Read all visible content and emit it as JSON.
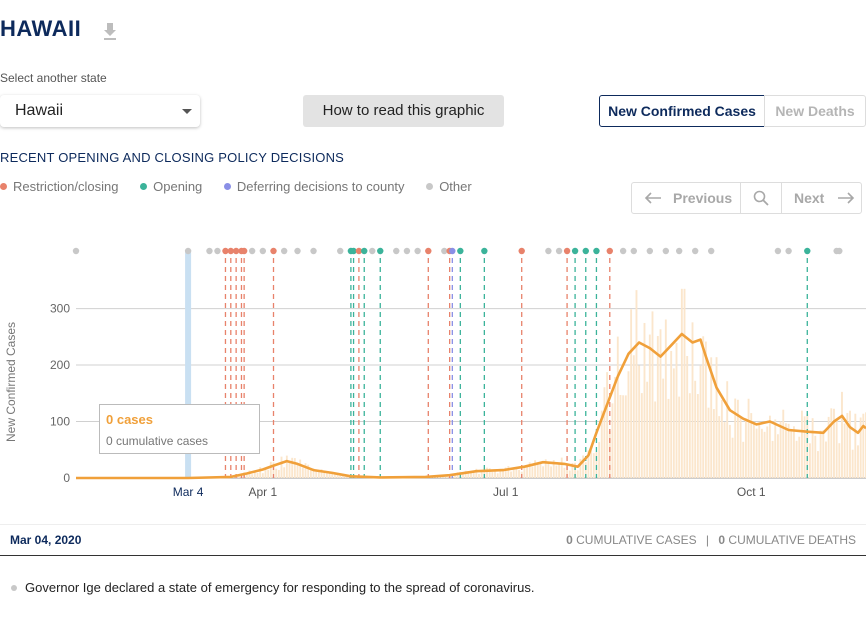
{
  "header": {
    "title": "HAWAII"
  },
  "state_selector": {
    "label": "Select another state",
    "value": "Hawaii"
  },
  "how_to_button": "How to read this graphic",
  "toggle": {
    "cases_label": "New Confirmed Cases",
    "deaths_label": "New Deaths"
  },
  "policy": {
    "heading": "RECENT OPENING AND CLOSING POLICY DECISIONS",
    "legend": [
      {
        "label": "Restriction/closing",
        "color": "#e8826b"
      },
      {
        "label": "Opening",
        "color": "#3bb39a"
      },
      {
        "label": "Deferring decisions to county",
        "color": "#8a8fe6"
      },
      {
        "label": "Other",
        "color": "#c8c8c8"
      }
    ]
  },
  "pager": {
    "prev_label": "Previous",
    "next_label": "Next"
  },
  "colors": {
    "line": "#f0a03a",
    "bars": "#fbe6cc",
    "selected_day": "#c9e0f2",
    "restriction": "#e8826b",
    "opening": "#3bb39a",
    "deferring": "#8a8fe6",
    "other": "#c8c8c8"
  },
  "chart_data": {
    "type": "line",
    "ylabel": "New Confirmed Cases",
    "yticks": [
      0,
      100,
      200,
      300
    ],
    "ylim": [
      0,
      340
    ],
    "x_domain": [
      "2020-01-22",
      "2020-11-13"
    ],
    "x_ticks": [
      {
        "date": "2020-03-04",
        "label": "Mar 4",
        "selected": true
      },
      {
        "date": "2020-04-01",
        "label": "Apr 1",
        "selected": false
      },
      {
        "date": "2020-07-01",
        "label": "Jul 1",
        "selected": false
      },
      {
        "date": "2020-10-01",
        "label": "Oct 1",
        "selected": false
      }
    ],
    "selected_date": "2020-03-04",
    "series": [
      {
        "kind": "moving-average line",
        "points": [
          [
            "2020-01-22",
            0
          ],
          [
            "2020-03-04",
            0
          ],
          [
            "2020-03-20",
            2
          ],
          [
            "2020-03-26",
            8
          ],
          [
            "2020-04-01",
            15
          ],
          [
            "2020-04-05",
            22
          ],
          [
            "2020-04-10",
            30
          ],
          [
            "2020-04-14",
            25
          ],
          [
            "2020-04-20",
            14
          ],
          [
            "2020-04-27",
            9
          ],
          [
            "2020-05-04",
            3
          ],
          [
            "2020-05-15",
            1
          ],
          [
            "2020-06-01",
            2
          ],
          [
            "2020-06-10",
            5
          ],
          [
            "2020-06-20",
            12
          ],
          [
            "2020-06-30",
            14
          ],
          [
            "2020-07-08",
            20
          ],
          [
            "2020-07-15",
            28
          ],
          [
            "2020-07-23",
            25
          ],
          [
            "2020-07-28",
            20
          ],
          [
            "2020-08-01",
            40
          ],
          [
            "2020-08-04",
            80
          ],
          [
            "2020-08-08",
            130
          ],
          [
            "2020-08-12",
            180
          ],
          [
            "2020-08-16",
            220
          ],
          [
            "2020-08-20",
            240
          ],
          [
            "2020-08-24",
            230
          ],
          [
            "2020-08-28",
            215
          ],
          [
            "2020-09-01",
            235
          ],
          [
            "2020-09-05",
            255
          ],
          [
            "2020-09-09",
            240
          ],
          [
            "2020-09-12",
            245
          ],
          [
            "2020-09-14",
            215
          ],
          [
            "2020-09-18",
            160
          ],
          [
            "2020-09-23",
            120
          ],
          [
            "2020-09-28",
            105
          ],
          [
            "2020-10-03",
            95
          ],
          [
            "2020-10-08",
            100
          ],
          [
            "2020-10-15",
            85
          ],
          [
            "2020-10-22",
            82
          ],
          [
            "2020-10-28",
            80
          ],
          [
            "2020-11-01",
            100
          ],
          [
            "2020-11-04",
            110
          ],
          [
            "2020-11-07",
            90
          ],
          [
            "2020-11-10",
            80
          ],
          [
            "2020-11-12",
            92
          ],
          [
            "2020-11-13",
            88
          ]
        ]
      }
    ],
    "policy_events": [
      {
        "date": "2020-01-22",
        "type": "other"
      },
      {
        "date": "2020-03-04",
        "type": "other"
      },
      {
        "date": "2020-03-12",
        "type": "other"
      },
      {
        "date": "2020-03-15",
        "type": "other"
      },
      {
        "date": "2020-03-18",
        "type": "restriction"
      },
      {
        "date": "2020-03-20",
        "type": "restriction"
      },
      {
        "date": "2020-03-22",
        "type": "restriction"
      },
      {
        "date": "2020-03-24",
        "type": "restriction"
      },
      {
        "date": "2020-03-25",
        "type": "restriction"
      },
      {
        "date": "2020-03-28",
        "type": "other"
      },
      {
        "date": "2020-04-01",
        "type": "other"
      },
      {
        "date": "2020-04-05",
        "type": "restriction"
      },
      {
        "date": "2020-04-09",
        "type": "other"
      },
      {
        "date": "2020-04-14",
        "type": "other"
      },
      {
        "date": "2020-04-20",
        "type": "other"
      },
      {
        "date": "2020-04-30",
        "type": "other"
      },
      {
        "date": "2020-05-04",
        "type": "opening"
      },
      {
        "date": "2020-05-05",
        "type": "opening"
      },
      {
        "date": "2020-05-07",
        "type": "restriction"
      },
      {
        "date": "2020-05-09",
        "type": "opening"
      },
      {
        "date": "2020-05-12",
        "type": "other"
      },
      {
        "date": "2020-05-15",
        "type": "opening"
      },
      {
        "date": "2020-05-21",
        "type": "other"
      },
      {
        "date": "2020-05-25",
        "type": "other"
      },
      {
        "date": "2020-05-29",
        "type": "other"
      },
      {
        "date": "2020-06-02",
        "type": "restriction"
      },
      {
        "date": "2020-06-08",
        "type": "other"
      },
      {
        "date": "2020-06-10",
        "type": "restriction"
      },
      {
        "date": "2020-06-11",
        "type": "deferring"
      },
      {
        "date": "2020-06-14",
        "type": "opening"
      },
      {
        "date": "2020-06-23",
        "type": "opening"
      },
      {
        "date": "2020-07-07",
        "type": "restriction"
      },
      {
        "date": "2020-07-17",
        "type": "other"
      },
      {
        "date": "2020-07-21",
        "type": "other"
      },
      {
        "date": "2020-07-24",
        "type": "restriction"
      },
      {
        "date": "2020-07-27",
        "type": "opening"
      },
      {
        "date": "2020-07-31",
        "type": "opening"
      },
      {
        "date": "2020-08-04",
        "type": "opening"
      },
      {
        "date": "2020-08-09",
        "type": "restriction"
      },
      {
        "date": "2020-08-14",
        "type": "other"
      },
      {
        "date": "2020-08-18",
        "type": "other"
      },
      {
        "date": "2020-08-24",
        "type": "other"
      },
      {
        "date": "2020-08-30",
        "type": "other"
      },
      {
        "date": "2020-09-04",
        "type": "other"
      },
      {
        "date": "2020-09-10",
        "type": "other"
      },
      {
        "date": "2020-09-16",
        "type": "other"
      },
      {
        "date": "2020-10-11",
        "type": "other"
      },
      {
        "date": "2020-10-15",
        "type": "other"
      },
      {
        "date": "2020-10-22",
        "type": "opening"
      },
      {
        "date": "2020-11-02",
        "type": "other"
      },
      {
        "date": "2020-11-03",
        "type": "other"
      }
    ]
  },
  "tooltip": {
    "cases": "0 cases",
    "cumulative": "0 cumulative cases"
  },
  "footer": {
    "date": "Mar 04, 2020",
    "cumulative_cases_value": "0",
    "cumulative_cases_label": "CUMULATIVE CASES",
    "separator": "|",
    "cumulative_deaths_value": "0",
    "cumulative_deaths_label": "CUMULATIVE DEATHS"
  },
  "events": [
    {
      "text": "Governor Ige declared a state of emergency for responding to the spread of coronavirus.",
      "type": "other"
    }
  ]
}
